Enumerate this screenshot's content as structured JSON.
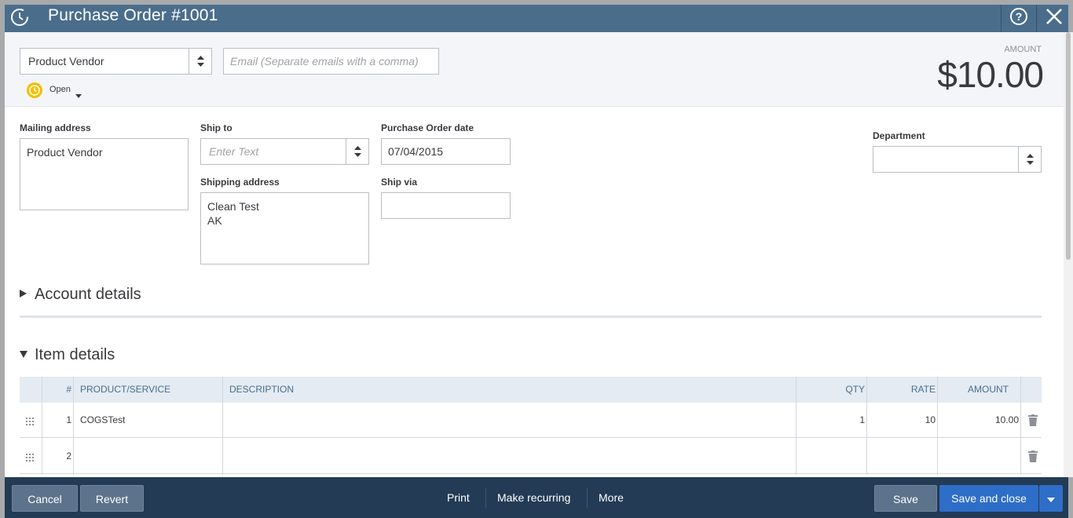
{
  "window": {
    "title": "Purchase Order #1001"
  },
  "vendor": {
    "value": "Product Vendor"
  },
  "email": {
    "placeholder": "Email (Separate emails with a comma)"
  },
  "status": {
    "label": "Open"
  },
  "amount": {
    "label": "AMOUNT",
    "value": "$10.00"
  },
  "mailing_address": {
    "label": "Mailing address",
    "value": "Product Vendor"
  },
  "ship_to": {
    "label": "Ship to",
    "placeholder": "Enter Text"
  },
  "shipping_address": {
    "label": "Shipping address",
    "line1": "Clean Test",
    "line2": "AK"
  },
  "po_date": {
    "label": "Purchase Order date",
    "value": "07/04/2015"
  },
  "ship_via": {
    "label": "Ship via",
    "value": ""
  },
  "department": {
    "label": "Department",
    "value": ""
  },
  "sections": {
    "account_details": "Account details",
    "item_details": "Item details"
  },
  "table": {
    "headers": {
      "num": "#",
      "product": "PRODUCT/SERVICE",
      "description": "DESCRIPTION",
      "qty": "QTY",
      "rate": "RATE",
      "amount": "AMOUNT"
    },
    "rows": [
      {
        "num": "1",
        "product": "COGSTest",
        "description": "",
        "qty": "1",
        "rate": "10",
        "amount": "10.00"
      },
      {
        "num": "2",
        "product": "",
        "description": "",
        "qty": "",
        "rate": "",
        "amount": ""
      }
    ]
  },
  "footer": {
    "cancel": "Cancel",
    "revert": "Revert",
    "print": "Print",
    "make_recurring": "Make recurring",
    "more": "More",
    "save": "Save",
    "save_and_close": "Save and close"
  },
  "colors": {
    "titlebar": "#4a6d8c",
    "footer": "#233b55",
    "primary_button": "#2e6ec8",
    "status_clock": "#f4c000"
  },
  "icons": [
    "history-icon",
    "help-icon",
    "close-icon",
    "sort-arrows-icon",
    "clock-icon",
    "caret-down-icon",
    "triangle-right-icon",
    "triangle-down-icon",
    "drag-handle-icon",
    "trash-icon"
  ]
}
